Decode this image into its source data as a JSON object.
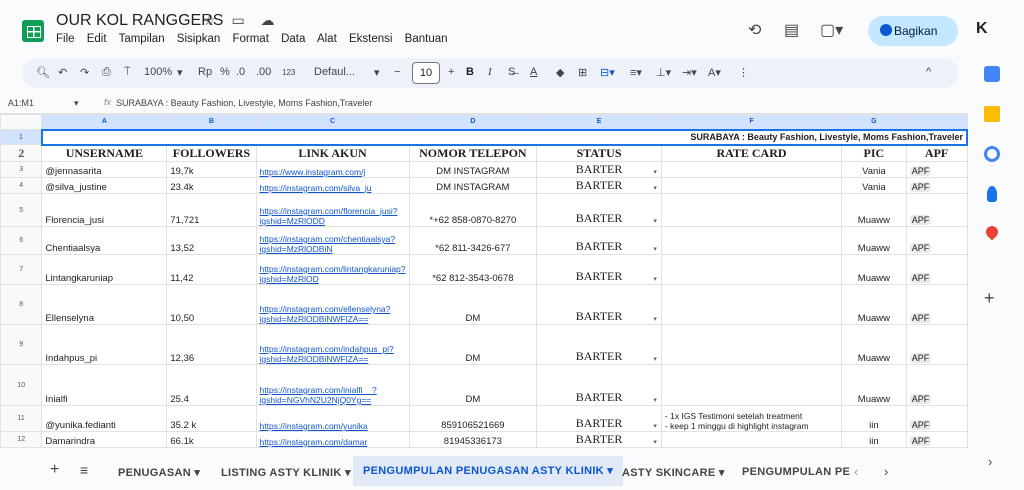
{
  "app": {
    "doc_title": "OUR KOL RANGGERS",
    "menu": [
      "File",
      "Edit",
      "Tampilan",
      "Sisipkan",
      "Format",
      "Data",
      "Alat",
      "Ekstensi",
      "Bantuan"
    ],
    "share_label": "Bagikan",
    "avatar_letter": "K"
  },
  "toolbar": {
    "zoom": "100%",
    "currency": "Rp",
    "percent": "%",
    "dec_less": ".0",
    "dec_more": ".00",
    "number_fmt": "123",
    "font": "Defaul...",
    "font_size": "10"
  },
  "formula_bar": {
    "name_box": "A1:M1",
    "fx": "fx",
    "value": "SURABAYA : Beauty Fashion, Livestyle, Moms Fashion,Traveler"
  },
  "grid": {
    "columns": [
      "A",
      "B",
      "C",
      "D",
      "E",
      "F",
      "G",
      ""
    ],
    "banner": "SURABAYA : Beauty Fashion, Livestyle, Moms Fashion,Traveler",
    "headers": [
      "UNSERNAME",
      "FOLLOWERS",
      "LINK AKUN",
      "NOMOR TELEPON",
      "STATUS",
      "RATE CARD",
      "PIC",
      "APF"
    ],
    "rows": [
      {
        "n": "3",
        "user": "@jennasarita",
        "followers": "19,7k",
        "link": "https://www.instagram.com/j",
        "phone": "DM INSTAGRAM",
        "status": "BARTER",
        "rate": "",
        "pic": "Vania",
        "apf": "APF"
      },
      {
        "n": "4",
        "user": "@silva_justine",
        "followers": "23.4k",
        "link": "https://instagram.com/silva_ju",
        "phone": "DM INSTAGRAM",
        "status": "BARTER",
        "rate": "",
        "pic": "Vania",
        "apf": "APF"
      },
      {
        "n": "5",
        "user": "Florencia_jusi",
        "followers": "71,721",
        "link": "https://instagram.com/florencia_jusi?igshid=MzRlODD",
        "phone": "*+62 858-0870-8270",
        "status": "BARTER",
        "rate": "",
        "pic": "Muaww",
        "apf": "APF"
      },
      {
        "n": "6",
        "user": "Chentiaalsya",
        "followers": "13,52",
        "link": "https://instagram.com/chentiaalsya?igshid=MzRlODBiN",
        "phone": "*62 811-3426-677",
        "status": "BARTER",
        "rate": "",
        "pic": "Muaww",
        "apf": "APF"
      },
      {
        "n": "7",
        "user": "Lintangkaruniap",
        "followers": "11,42",
        "link": "https://instagram.com/lintangkaruniap?igshid=MzRlOD",
        "phone": "*62 812-3543-0678",
        "status": "BARTER",
        "rate": "",
        "pic": "Muaww",
        "apf": "APF"
      },
      {
        "n": "8",
        "user": "Ellenselyna",
        "followers": "10,50",
        "link": "https://instagram.com/ellenselyna?igshid=MzRlODBiNWFlZA==",
        "phone": "DM",
        "status": "BARTER",
        "rate": "",
        "pic": "Muaww",
        "apf": "APF"
      },
      {
        "n": "9",
        "user": "Indahpus_pi",
        "followers": "12,36",
        "link": "https://instagram.com/indahpus_pi?igshid=MzRlODBiNWFlZA==",
        "phone": "DM",
        "status": "BARTER",
        "rate": "",
        "pic": "Muaww",
        "apf": "APF"
      },
      {
        "n": "10",
        "user": "Inialfi",
        "followers": "25.4",
        "link": "https://instagram.com/inialfi__?igshid=NGVhN2U2NjQ0Yg==",
        "phone": "DM",
        "status": "BARTER",
        "rate": "",
        "pic": "Muaww",
        "apf": "APF"
      },
      {
        "n": "11",
        "user": "@yunika.fedianti",
        "followers": "35.2 k",
        "link": "https://instagram.com/yunika",
        "phone": "859106521669",
        "status": "BARTER",
        "rate": "- 1x IGS Testimoni setelah treatment\n- keep 1 minggu di highlight instagram",
        "pic": "iin",
        "apf": "APF"
      },
      {
        "n": "12",
        "user": "Damarindra",
        "followers": "66.1k",
        "link": "https://instagram.com/damar",
        "phone": "81945336173",
        "status": "BARTER",
        "rate": "",
        "pic": "iin",
        "apf": "APF"
      }
    ]
  },
  "tabs": {
    "items": [
      "PENUGASAN",
      "LISTING ASTY KLINIK",
      "PENGUMPULAN PENUGASAN ASTY KLINIK",
      "ASTY SKINCARE",
      "PENGUMPULAN PE"
    ],
    "active_index": 2
  },
  "colors": {
    "accent": "#0b57d0",
    "share_bg": "#c2e7ff",
    "sheets_green": "#0f9d58"
  }
}
